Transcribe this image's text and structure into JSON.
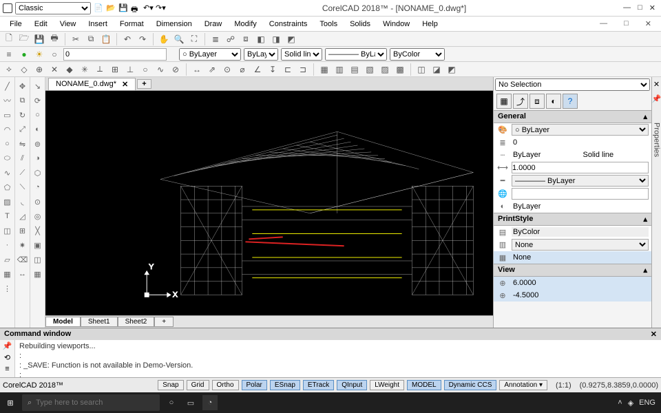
{
  "app": {
    "workspace_selected": "Classic",
    "title": "CorelCAD 2018™ - [NONAME_0.dwg*]",
    "brand_footer": "CorelCAD 2018™"
  },
  "menus": [
    "File",
    "Edit",
    "View",
    "Insert",
    "Format",
    "Dimension",
    "Draw",
    "Modify",
    "Constraints",
    "Tools",
    "Solids",
    "Window",
    "Help"
  ],
  "layer_row": {
    "layer_val": "0",
    "color_sel": "○ ByLayer",
    "ls_sel": "ByLayer",
    "style_sel": "Solid line",
    "lw_sel": "———— ByLayer",
    "print_sel": "ByColor"
  },
  "doc_tab": {
    "name": "NONAME_0.dwg*"
  },
  "sheet_tabs": [
    "Model",
    "Sheet1",
    "Sheet2"
  ],
  "properties": {
    "selection": "No Selection",
    "sections": {
      "general": {
        "title": "General",
        "color": "○ ByLayer",
        "layer": "0",
        "linestyle_a": "ByLayer",
        "linestyle_b": "Solid line",
        "scale": "1.0000",
        "lineweight": "———— ByLayer",
        "hyperlink": "",
        "transparency": "ByLayer"
      },
      "printstyle": {
        "title": "PrintStyle",
        "val": "ByColor",
        "none1": "None",
        "none2": "None"
      },
      "view": {
        "title": "View",
        "v1": "6.0000",
        "v2": "-4.5000"
      }
    }
  },
  "cmd": {
    "title": "Command window",
    "lines": [
      "Rebuilding viewports...",
      ":",
      ": _SAVE: Function is not available in Demo-Version.",
      ":"
    ]
  },
  "status": {
    "buttons": [
      "Snap",
      "Grid",
      "Ortho",
      "Polar",
      "ESnap",
      "ETrack",
      "QInput",
      "LWeight",
      "MODEL",
      "Dynamic CCS",
      "Annotation ▾"
    ],
    "active": [
      3,
      4,
      5,
      6,
      8,
      9
    ],
    "ratio": "(1:1)",
    "coords": "(0.9275,8.3859,0.0000)"
  },
  "taskbar": {
    "search_placeholder": "Type here to search",
    "lang": "ENG",
    "net": "◈"
  },
  "right_edge_label": "Properties"
}
